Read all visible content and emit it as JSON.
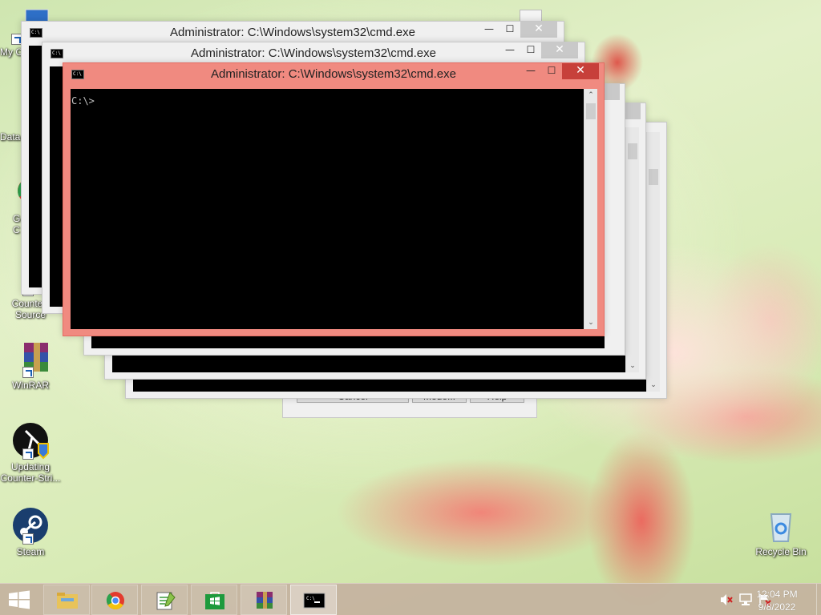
{
  "desktop_icons": [
    {
      "label": "My Computer",
      "visible_label": "My C",
      "icon": "computer-icon"
    },
    {
      "label": "Data",
      "visible_label": "Data",
      "icon": "shortcut-icon"
    },
    {
      "label": "Google Chrome",
      "visible_label": "G\nC",
      "icon": "chrome-icon"
    },
    {
      "label": "Counter-Strike: Source",
      "visible_label": "Counter-\nSource",
      "icon": "cs-source-icon"
    },
    {
      "label": "WinRAR",
      "visible_label": "WinRAR",
      "icon": "winrar-icon"
    },
    {
      "label": "Updating Counter-Strike",
      "visible_label": "Updating\nCounter-Stri...",
      "icon": "cs-update-icon"
    },
    {
      "label": "Steam",
      "visible_label": "Steam",
      "icon": "steam-icon"
    },
    {
      "label": "Recycle Bin",
      "visible_label": "Recycle Bin",
      "icon": "recycle-bin-icon"
    }
  ],
  "windows": [
    {
      "title": "Administrator: C:\\Windows\\system32\\cmd.exe",
      "state": "inactive"
    },
    {
      "title": "Administrator: C:\\Windows\\system32\\cmd.exe",
      "state": "inactive"
    },
    {
      "title": "Administrator: C:\\Windows\\system32\\cmd.exe",
      "state": "active",
      "prompt": "C:\\>"
    }
  ],
  "window_controls": {
    "minimize": "—",
    "maximize": "☐",
    "close": "✕"
  },
  "dialog_buttons": [
    "Cancel",
    "Mode...",
    "Help"
  ],
  "taskbar": {
    "items": [
      {
        "name": "File Explorer",
        "icon": "folder-icon",
        "state": "pinned"
      },
      {
        "name": "Google Chrome",
        "icon": "chrome-icon",
        "state": "pinned"
      },
      {
        "name": "Notepad++",
        "icon": "notepad-plus-icon",
        "state": "pinned"
      },
      {
        "name": "Store",
        "icon": "store-icon",
        "state": "pinned"
      },
      {
        "name": "WinRAR",
        "icon": "winrar-icon",
        "state": "running"
      },
      {
        "name": "Command Prompt",
        "icon": "cmd-icon",
        "state": "active"
      }
    ],
    "tray": [
      "volume-muted-icon",
      "network-icon",
      "action-center-flag-icon"
    ],
    "clock_time": "12:04 PM",
    "clock_date": "9/8/2022"
  },
  "colors": {
    "active_frame": "#f08a80",
    "active_close": "#c7403a",
    "console_bg": "#000000"
  }
}
